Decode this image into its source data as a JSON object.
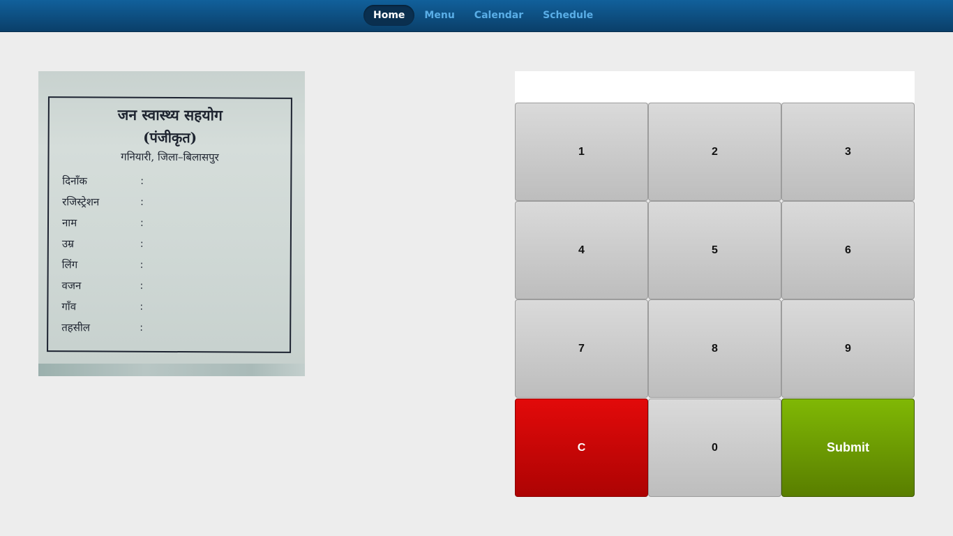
{
  "nav": {
    "items": [
      {
        "label": "Home",
        "active": true
      },
      {
        "label": "Menu",
        "active": false
      },
      {
        "label": "Calendar",
        "active": false
      },
      {
        "label": "Schedule",
        "active": false
      }
    ]
  },
  "form": {
    "title_line1": "जन स्वास्थ्य सहयोग",
    "title_line2": "(पंजीकृत)",
    "title_line3": "गनियारी, जिला–बिलासपुर",
    "fields": [
      "दिनाँक",
      "रजिस्ट्रेशन",
      "नाम",
      "उम्र",
      "लिंग",
      "वजन",
      "गाँव",
      "तहसील"
    ],
    "colon": ":"
  },
  "keypad": {
    "display_value": "",
    "keys": [
      "1",
      "2",
      "3",
      "4",
      "5",
      "6",
      "7",
      "8",
      "9",
      "C",
      "0",
      "Submit"
    ]
  },
  "colors": {
    "topbar": "#0e5588",
    "nav_inactive": "#5aaee7",
    "clear": "#d40606",
    "submit": "#6e9c02"
  }
}
